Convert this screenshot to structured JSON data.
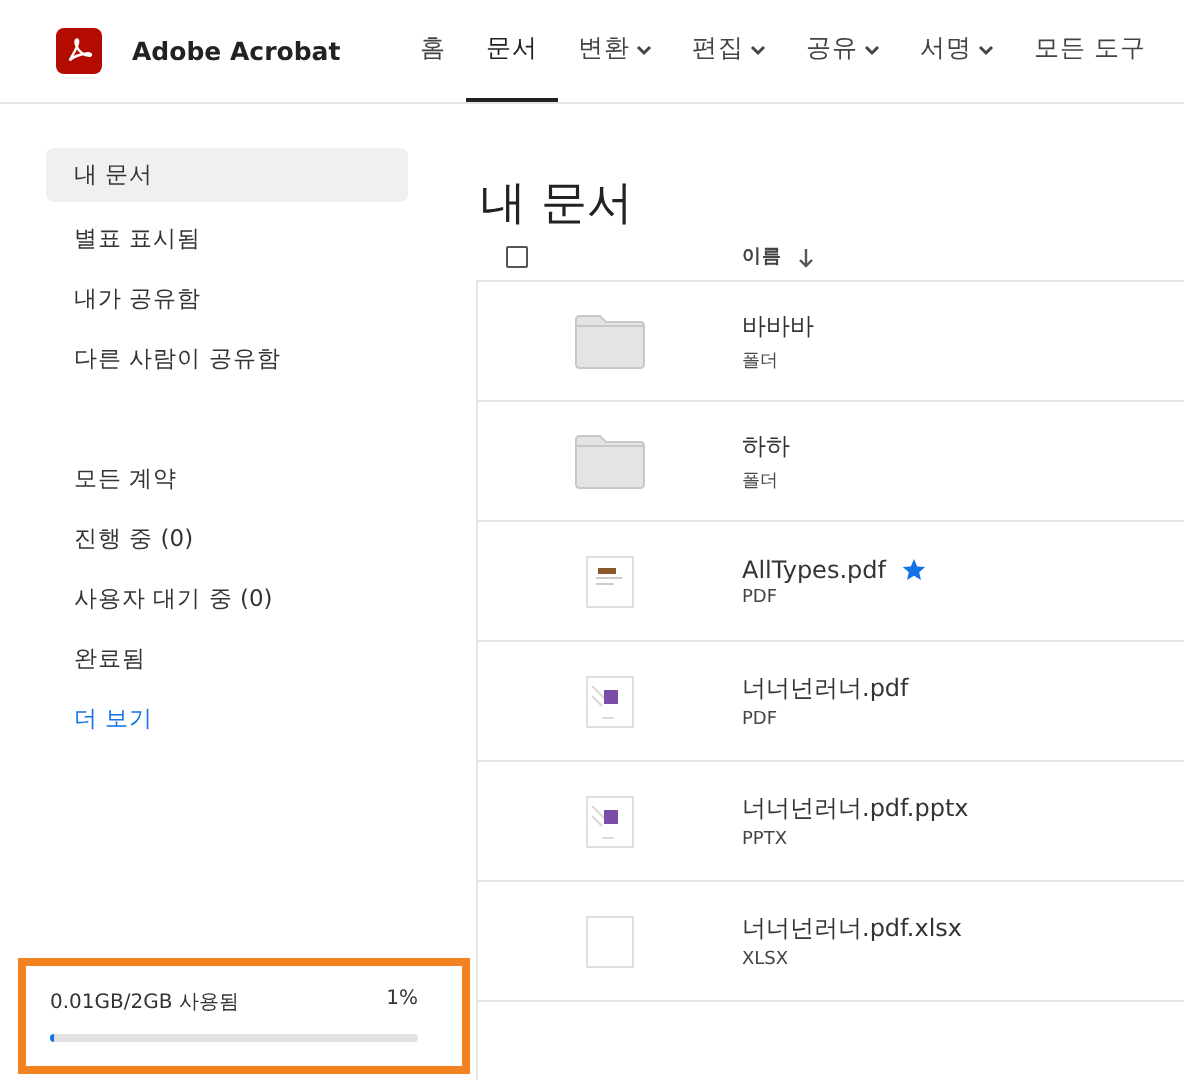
{
  "header": {
    "app_name": "Adobe Acrobat",
    "nav": [
      {
        "label": "홈",
        "selected": false,
        "has_menu": false
      },
      {
        "label": "문서",
        "selected": true,
        "has_menu": false
      },
      {
        "label": "변환",
        "selected": false,
        "has_menu": true
      },
      {
        "label": "편집",
        "selected": false,
        "has_menu": true
      },
      {
        "label": "공유",
        "selected": false,
        "has_menu": true
      },
      {
        "label": "서명",
        "selected": false,
        "has_menu": true
      },
      {
        "label": "모든 도구",
        "selected": false,
        "has_menu": false
      }
    ]
  },
  "sidebar": {
    "groups": [
      [
        {
          "label": "내 문서",
          "selected": true,
          "kind": "item"
        },
        {
          "label": "별표 표시됨",
          "selected": false,
          "kind": "item"
        },
        {
          "label": "내가 공유함",
          "selected": false,
          "kind": "item"
        },
        {
          "label": "다른 사람이 공유함",
          "selected": false,
          "kind": "item"
        }
      ],
      [
        {
          "label": "모든 계약",
          "selected": false,
          "kind": "item"
        },
        {
          "label": "진행 중 (0)",
          "selected": false,
          "kind": "item"
        },
        {
          "label": "사용자 대기 중 (0)",
          "selected": false,
          "kind": "item"
        },
        {
          "label": "완료됨",
          "selected": false,
          "kind": "item"
        },
        {
          "label": "더 보기",
          "selected": false,
          "kind": "link"
        }
      ]
    ],
    "storage": {
      "label": "0.01GB/2GB 사용됨",
      "percent": "1%",
      "level": 0.01,
      "highlighted": true
    }
  },
  "main": {
    "title": "내 문서",
    "table": {
      "select_all_checked": false,
      "name_column": "이름",
      "rows": [
        {
          "name": "바바바",
          "type": "폴더",
          "kind": "folder",
          "starred": false
        },
        {
          "name": "하하",
          "type": "폴더",
          "kind": "folder",
          "starred": false
        },
        {
          "name": "AllTypes.pdf",
          "type": "PDF",
          "kind": "photo",
          "starred": true
        },
        {
          "name": "너너넌러너.pdf",
          "type": "PDF",
          "kind": "purple",
          "starred": false
        },
        {
          "name": "너너넌러너.pdf.pptx",
          "type": "PPTX",
          "kind": "purple",
          "starred": false
        },
        {
          "name": "너너넌러너.pdf.xlsx",
          "type": "XLSX",
          "kind": "blank",
          "starred": false
        }
      ]
    }
  }
}
